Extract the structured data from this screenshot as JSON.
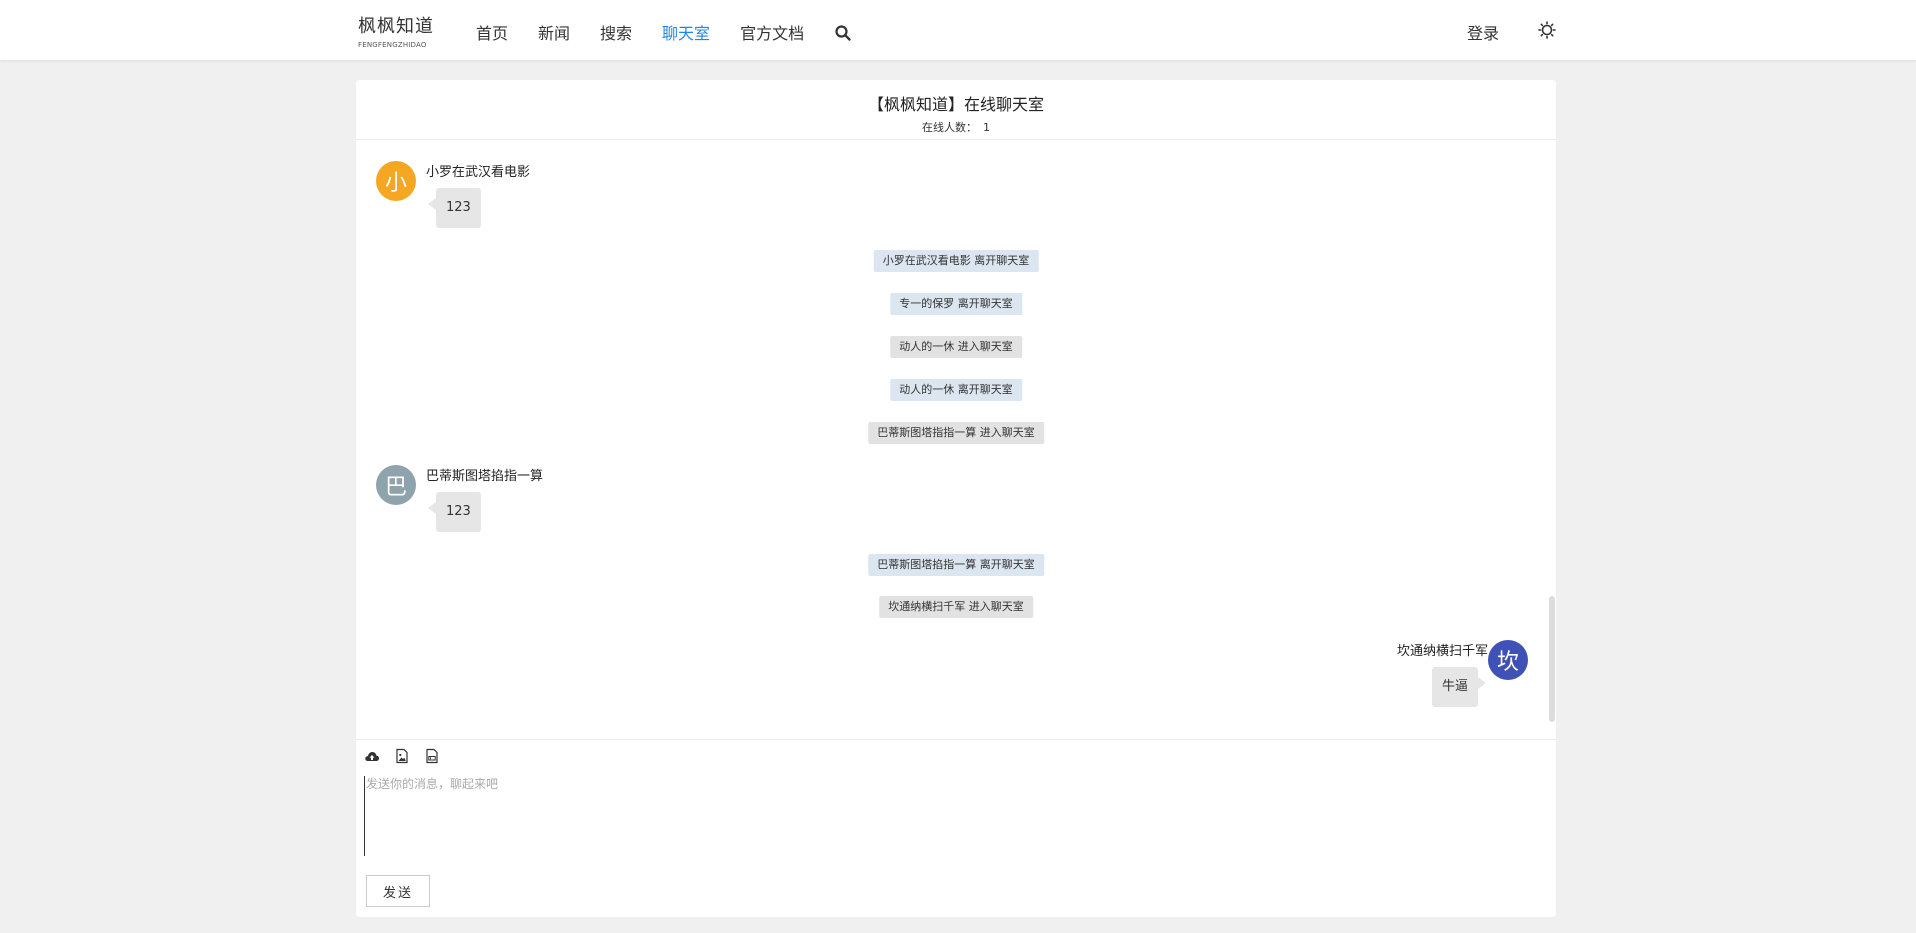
{
  "header": {
    "logo_main": "枫枫知道",
    "logo_sub": "FENGFENGZHIDAO",
    "nav": [
      {
        "label": "首页",
        "active": false
      },
      {
        "label": "新闻",
        "active": false
      },
      {
        "label": "搜索",
        "active": false
      },
      {
        "label": "聊天室",
        "active": true
      },
      {
        "label": "官方文档",
        "active": false
      }
    ],
    "login_label": "登录",
    "accent_color": "#1e88e5"
  },
  "chat": {
    "title": "【枫枫知道】在线聊天室",
    "online_label": "在线人数：",
    "online_count": "1",
    "messages": [
      {
        "kind": "user",
        "side": "left",
        "avatar_char": "小",
        "avatar_color": "#f5a623",
        "sender": "小罗在武汉看电影",
        "text": "123"
      },
      {
        "kind": "system",
        "style": "blue",
        "text": "小罗在武汉看电影 离开聊天室"
      },
      {
        "kind": "system",
        "style": "blue",
        "text": "专一的保罗 离开聊天室"
      },
      {
        "kind": "system",
        "style": "gray",
        "text": "动人的一休 进入聊天室"
      },
      {
        "kind": "system",
        "style": "blue",
        "text": "动人的一休 离开聊天室"
      },
      {
        "kind": "system",
        "style": "gray",
        "text": "巴蒂斯图塔指指一算 进入聊天室"
      },
      {
        "kind": "user",
        "side": "left",
        "avatar_char": "巴",
        "avatar_color": "#8fa3ad",
        "sender": "巴蒂斯图塔掐指一算",
        "text": "123"
      },
      {
        "kind": "system",
        "style": "blue",
        "text": "巴蒂斯图塔掐指一算 离开聊天室"
      },
      {
        "kind": "system",
        "style": "gray",
        "text": "坎通纳横扫千军 进入聊天室"
      },
      {
        "kind": "user",
        "side": "right",
        "avatar_char": "坎",
        "avatar_color": "#3f51b5",
        "sender": "坎通纳横扫千军",
        "text": "牛逼"
      }
    ]
  },
  "composer": {
    "placeholder": "发送你的消息，聊起来吧",
    "send_label": "发送",
    "tools": [
      "upload-cloud-icon",
      "image-icon",
      "file-icon"
    ]
  }
}
